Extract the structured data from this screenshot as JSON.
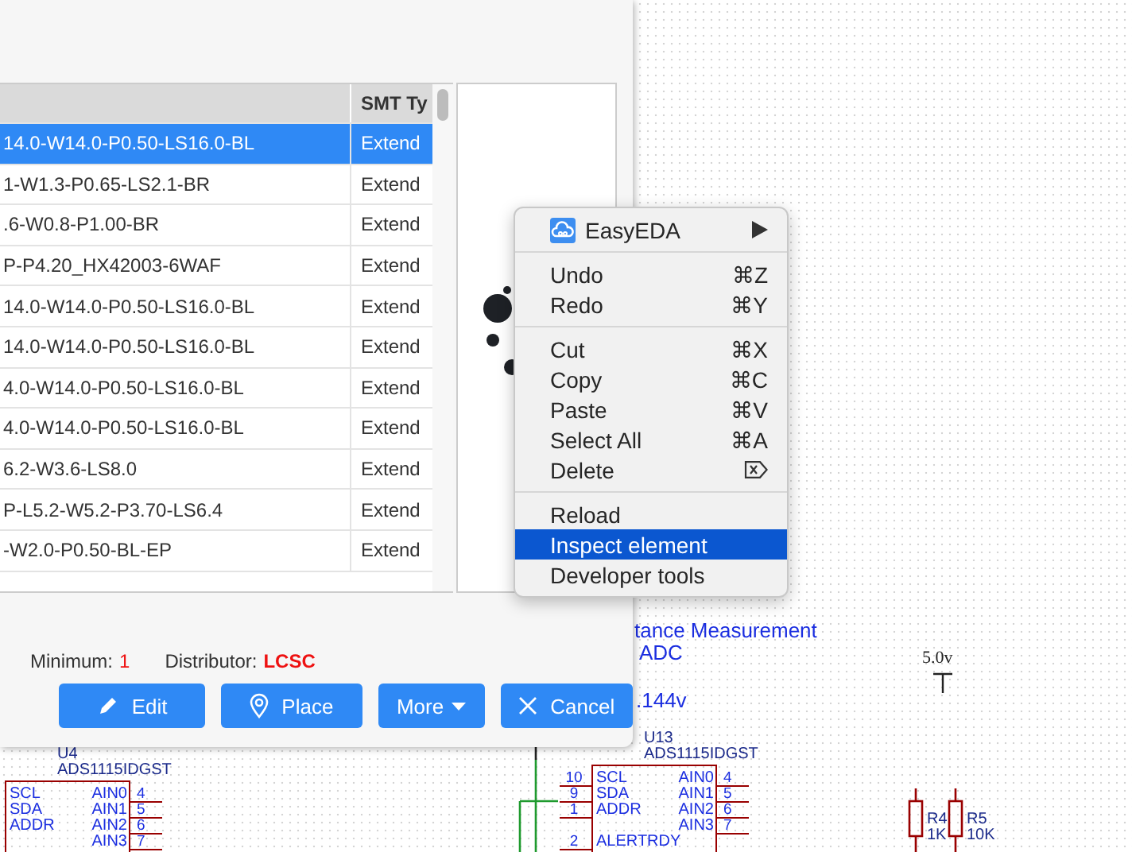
{
  "dialog": {
    "table": {
      "columns": [
        "",
        "SMT Ty"
      ],
      "rows": [
        {
          "cells": [
            "14.0-W14.0-P0.50-LS16.0-BL",
            "Extend"
          ],
          "selected": true
        },
        {
          "cells": [
            "1-W1.3-P0.65-LS2.1-BR",
            "Extend"
          ],
          "selected": false
        },
        {
          "cells": [
            ".6-W0.8-P1.00-BR",
            "Extend"
          ],
          "selected": false
        },
        {
          "cells": [
            "P-P4.20_HX42003-6WAF",
            "Extend"
          ],
          "selected": false
        },
        {
          "cells": [
            "14.0-W14.0-P0.50-LS16.0-BL",
            "Extend"
          ],
          "selected": false
        },
        {
          "cells": [
            "14.0-W14.0-P0.50-LS16.0-BL",
            "Extend"
          ],
          "selected": false
        },
        {
          "cells": [
            "4.0-W14.0-P0.50-LS16.0-BL",
            "Extend"
          ],
          "selected": false
        },
        {
          "cells": [
            "4.0-W14.0-P0.50-LS16.0-BL",
            "Extend"
          ],
          "selected": false
        },
        {
          "cells": [
            "6.2-W3.6-LS8.0",
            "Extend"
          ],
          "selected": false
        },
        {
          "cells": [
            "P-L5.2-W5.2-P3.70-LS6.4",
            "Extend"
          ],
          "selected": false
        },
        {
          "cells": [
            "-W2.0-P0.50-BL-EP",
            "Extend"
          ],
          "selected": false
        }
      ]
    },
    "info": [
      {
        "label": "Minimum:",
        "value": "1",
        "kind": "plain"
      },
      {
        "label": "Distributor:",
        "value": "LCSC",
        "kind": "bold"
      }
    ],
    "buttons": [
      {
        "label": "Edit",
        "kind": "edit"
      },
      {
        "label": "Place",
        "kind": "place"
      },
      {
        "label": "More",
        "kind": "more"
      },
      {
        "label": "Cancel",
        "kind": "cancel"
      }
    ]
  },
  "context_menu": {
    "groups": [
      [
        {
          "label": "EasyEDA",
          "kind": "app",
          "selected": false
        }
      ],
      [
        {
          "label": "Undo",
          "kind": "shortcut",
          "shortcut": "⌘Z",
          "selected": false
        },
        {
          "label": "Redo",
          "kind": "shortcut",
          "shortcut": "⌘Y",
          "selected": false
        }
      ],
      [
        {
          "label": "Cut",
          "kind": "shortcut",
          "shortcut": "⌘X",
          "selected": false
        },
        {
          "label": "Copy",
          "kind": "shortcut",
          "shortcut": "⌘C",
          "selected": false
        },
        {
          "label": "Paste",
          "kind": "shortcut",
          "shortcut": "⌘V",
          "selected": false
        },
        {
          "label": "Select All",
          "kind": "shortcut",
          "shortcut": "⌘A",
          "selected": false
        },
        {
          "label": "Delete",
          "kind": "delete",
          "selected": false
        }
      ],
      [
        {
          "label": "Reload",
          "kind": "plain",
          "selected": false
        },
        {
          "label": "Inspect element",
          "kind": "plain",
          "selected": true
        },
        {
          "label": "Developer tools",
          "kind": "plain",
          "selected": false
        }
      ]
    ]
  },
  "schematic": {
    "notes": [
      "tance Measurement",
      "ADC",
      ".144v"
    ],
    "net_label": "5.0v",
    "components": [
      {
        "designator": "U4",
        "value": "ADS1115IDGST",
        "left_pins": [
          {
            "name": "SCL"
          },
          {
            "name": "SDA"
          },
          {
            "name": "ADDR"
          }
        ],
        "right_pins": [
          {
            "name": "AIN0",
            "number": "4"
          },
          {
            "name": "AIN1",
            "number": "5"
          },
          {
            "name": "AIN2",
            "number": "6"
          },
          {
            "name": "AIN3",
            "number": "7"
          }
        ]
      },
      {
        "designator": "U13",
        "value": "ADS1115IDGST",
        "left_pins": [
          {
            "name": "SCL",
            "number": "10"
          },
          {
            "name": "SDA",
            "number": "9"
          },
          {
            "name": "ADDR",
            "number": "1"
          },
          {
            "name": "ALERTRDY",
            "number": "2"
          }
        ],
        "right_pins": [
          {
            "name": "AIN0",
            "number": "4"
          },
          {
            "name": "AIN1",
            "number": "5"
          },
          {
            "name": "AIN2",
            "number": "6"
          },
          {
            "name": "AIN3",
            "number": "7"
          }
        ]
      }
    ],
    "resistors": [
      {
        "designator": "R4",
        "value": "1K"
      },
      {
        "designator": "R5",
        "value": "10K"
      }
    ]
  }
}
